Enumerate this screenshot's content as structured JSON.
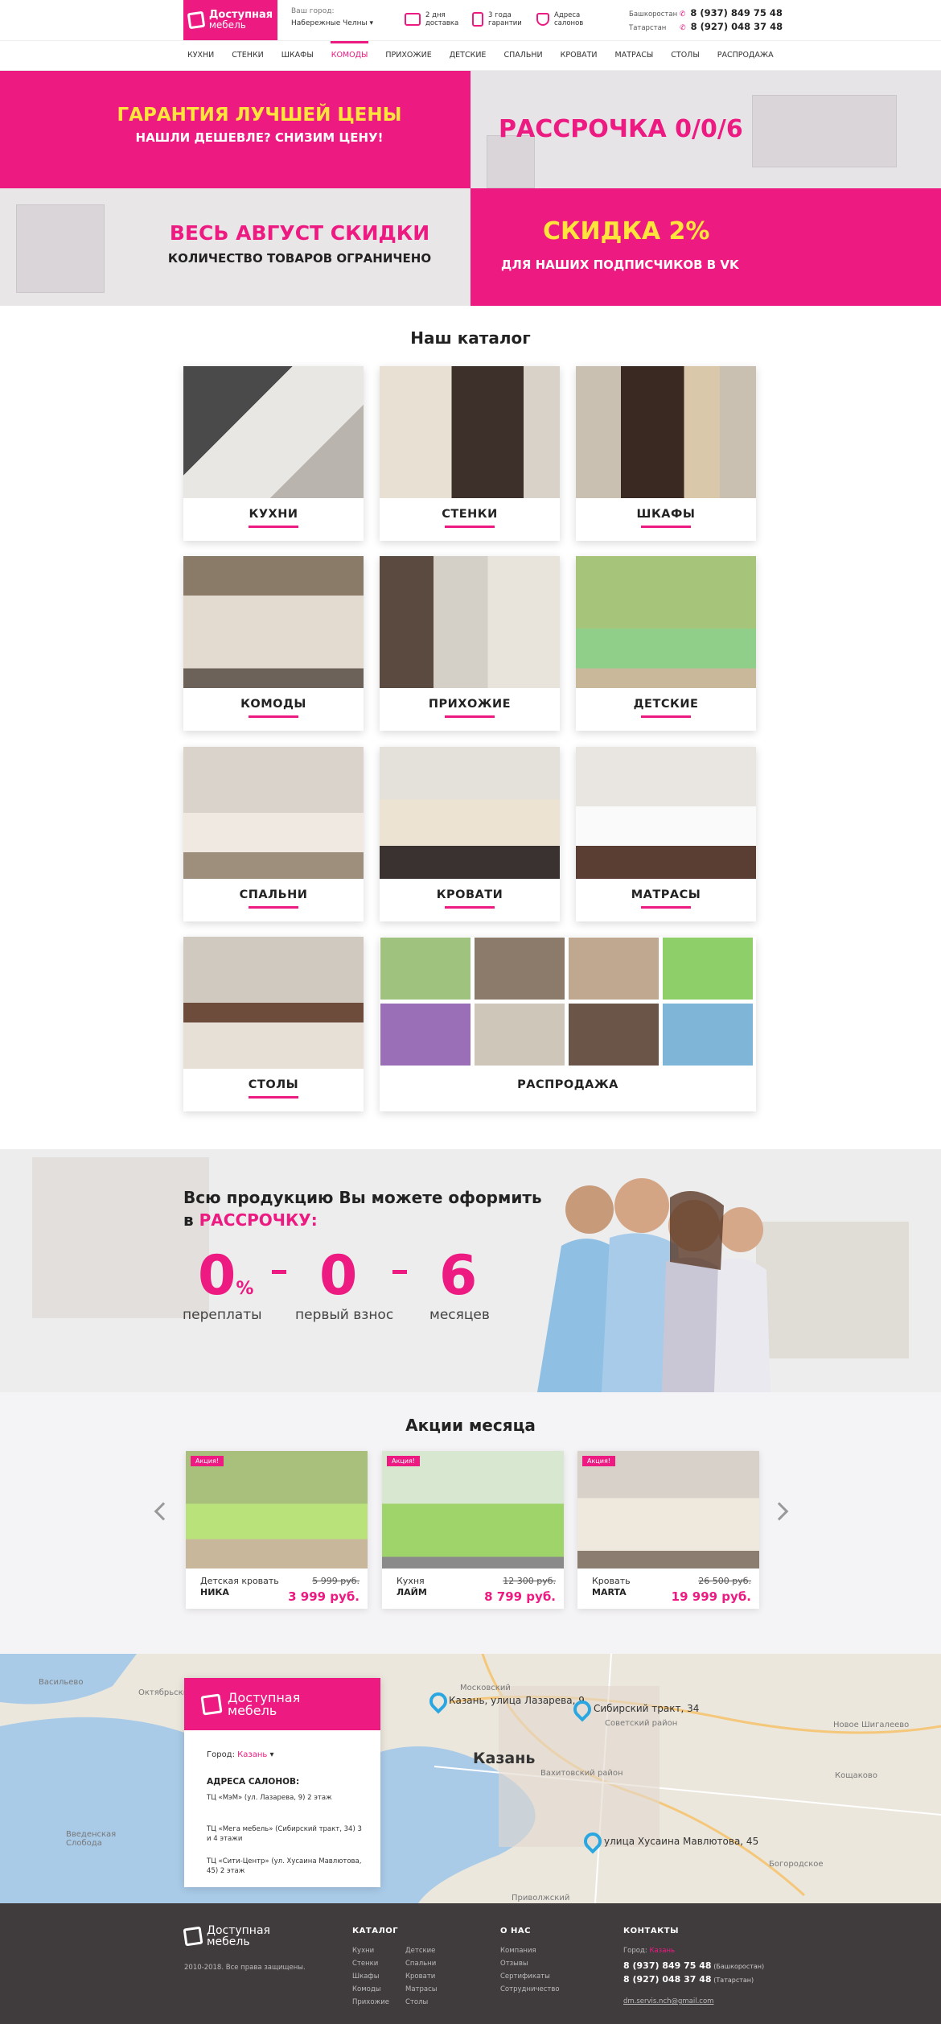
{
  "header": {
    "logo_line1": "Доступная",
    "logo_line2": "мебель",
    "city_label": "Ваш город:",
    "city_value": "Набережные Челны",
    "info": [
      {
        "line1": "2 дня",
        "line2": "доставка"
      },
      {
        "line1": "3 года",
        "line2": "гарантии"
      },
      {
        "line1": "Адреса",
        "line2": "салонов"
      }
    ],
    "phones": [
      {
        "region": "Башкоростан",
        "number": "8 (937) 849 75 48"
      },
      {
        "region": "Татарстан",
        "number": "8 (927) 048 37 48"
      }
    ]
  },
  "nav": [
    "КУХНИ",
    "СТЕНКИ",
    "ШКАФЫ",
    "КОМОДЫ",
    "ПРИХОЖИЕ",
    "ДЕТСКИЕ",
    "СПАЛЬНИ",
    "КРОВАТИ",
    "МАТРАСЫ",
    "СТОЛЫ",
    "РАСПРОДАЖА"
  ],
  "nav_active": "КОМОДЫ",
  "promo": {
    "p1_title": "ГАРАНТИЯ ЛУЧШЕЙ ЦЕНЫ",
    "p1_sub": "НАШЛИ ДЕШЕВЛЕ? СНИЗИМ ЦЕНУ!",
    "p2_title": "РАССРОЧКА 0/0/6",
    "p3_title": "ВЕСЬ АВГУСТ СКИДКИ",
    "p3_sub": "КОЛИЧЕСТВО ТОВАРОВ ОГРАНИЧЕНО",
    "p4_title": "СКИДКА 2%",
    "p4_sub": "ДЛЯ НАШИХ ПОДПИСЧИКОВ В VK"
  },
  "catalog": {
    "title": "Наш каталог",
    "items": [
      "КУХНИ",
      "СТЕНКИ",
      "ШКАФЫ",
      "КОМОДЫ",
      "ПРИХОЖИЕ",
      "ДЕТСКИЕ",
      "СПАЛЬНИ",
      "КРОВАТИ",
      "МАТРАСЫ",
      "СТОЛЫ",
      "РАСПРОДАЖА"
    ]
  },
  "installment": {
    "line1": "Всю продукцию Вы можете оформить",
    "line2_prefix": "в",
    "line2_accent": "РАССРОЧКУ:",
    "n1": "0",
    "n1_unit": "%",
    "n2": "0",
    "n3": "6",
    "l1": "переплаты",
    "l2": "первый взнос",
    "l3": "месяцев"
  },
  "actions": {
    "title": "Акции месяца",
    "badge": "Акция!",
    "products": [
      {
        "type": "Детская кровать",
        "name": "НИКА",
        "old": "5 999 руб.",
        "new": "3 999 руб."
      },
      {
        "type": "Кухня",
        "name": "ЛАЙМ",
        "old": "12 300 руб.",
        "new": "8 799 руб."
      },
      {
        "type": "Кровать",
        "name": "MARTA",
        "old": "26 500 руб.",
        "new": "19 999 руб."
      }
    ]
  },
  "map": {
    "city_label": "Город:",
    "city_value": "Казань",
    "addr_title": "АДРЕСА САЛОНОВ:",
    "addresses": [
      "ТЦ «МэМ» (ул. Лазарева, 9) 2 этаж",
      "ТЦ «Мега мебель» (Сибирский тракт, 34) 3 и 4 этажи",
      "ТЦ «Сити-Центр» (ул. Хусаина Мавлютова, 45) 2 этаж"
    ],
    "pins": [
      "Казань, улица Лазарева, 9",
      "Сибирский тракт, 34",
      "улица Хусаина Мавлютова, 45"
    ],
    "map_city": "Казань",
    "places": [
      "Васильево",
      "Октябрьский",
      "Московский",
      "Советский район",
      "Новое Шигалеево",
      "Вахитовский район",
      "Кощаково",
      "Введенская Слобода",
      "Богородское",
      "Приволжский"
    ]
  },
  "footer": {
    "copyright": "2010-2018. Все права защищены.",
    "catalog_title": "КАТАЛОГ",
    "catalog_col1": [
      "Кухни",
      "Стенки",
      "Шкафы",
      "Комоды",
      "Прихожие"
    ],
    "catalog_col2": [
      "Детские",
      "Спальни",
      "Кровати",
      "Матрасы",
      "Столы"
    ],
    "about_title": "О НАС",
    "about_links": [
      "Компания",
      "Отзывы",
      "Сертификаты",
      "Сотрудничество"
    ],
    "contacts_title": "КОНТАКТЫ",
    "contacts_city_label": "Город:",
    "contacts_city": "Казань",
    "phone1": "8 (937) 849 75 48",
    "phone1_region": "(Башкоростан)",
    "phone2": "8 (927) 048 37 48",
    "phone2_region": "(Татарстан)",
    "email": "dm.servis.nch@gmail.com"
  },
  "colors": {
    "accent": "#ec1a81",
    "yellow": "#ffe53b",
    "footer": "#403b3d"
  }
}
